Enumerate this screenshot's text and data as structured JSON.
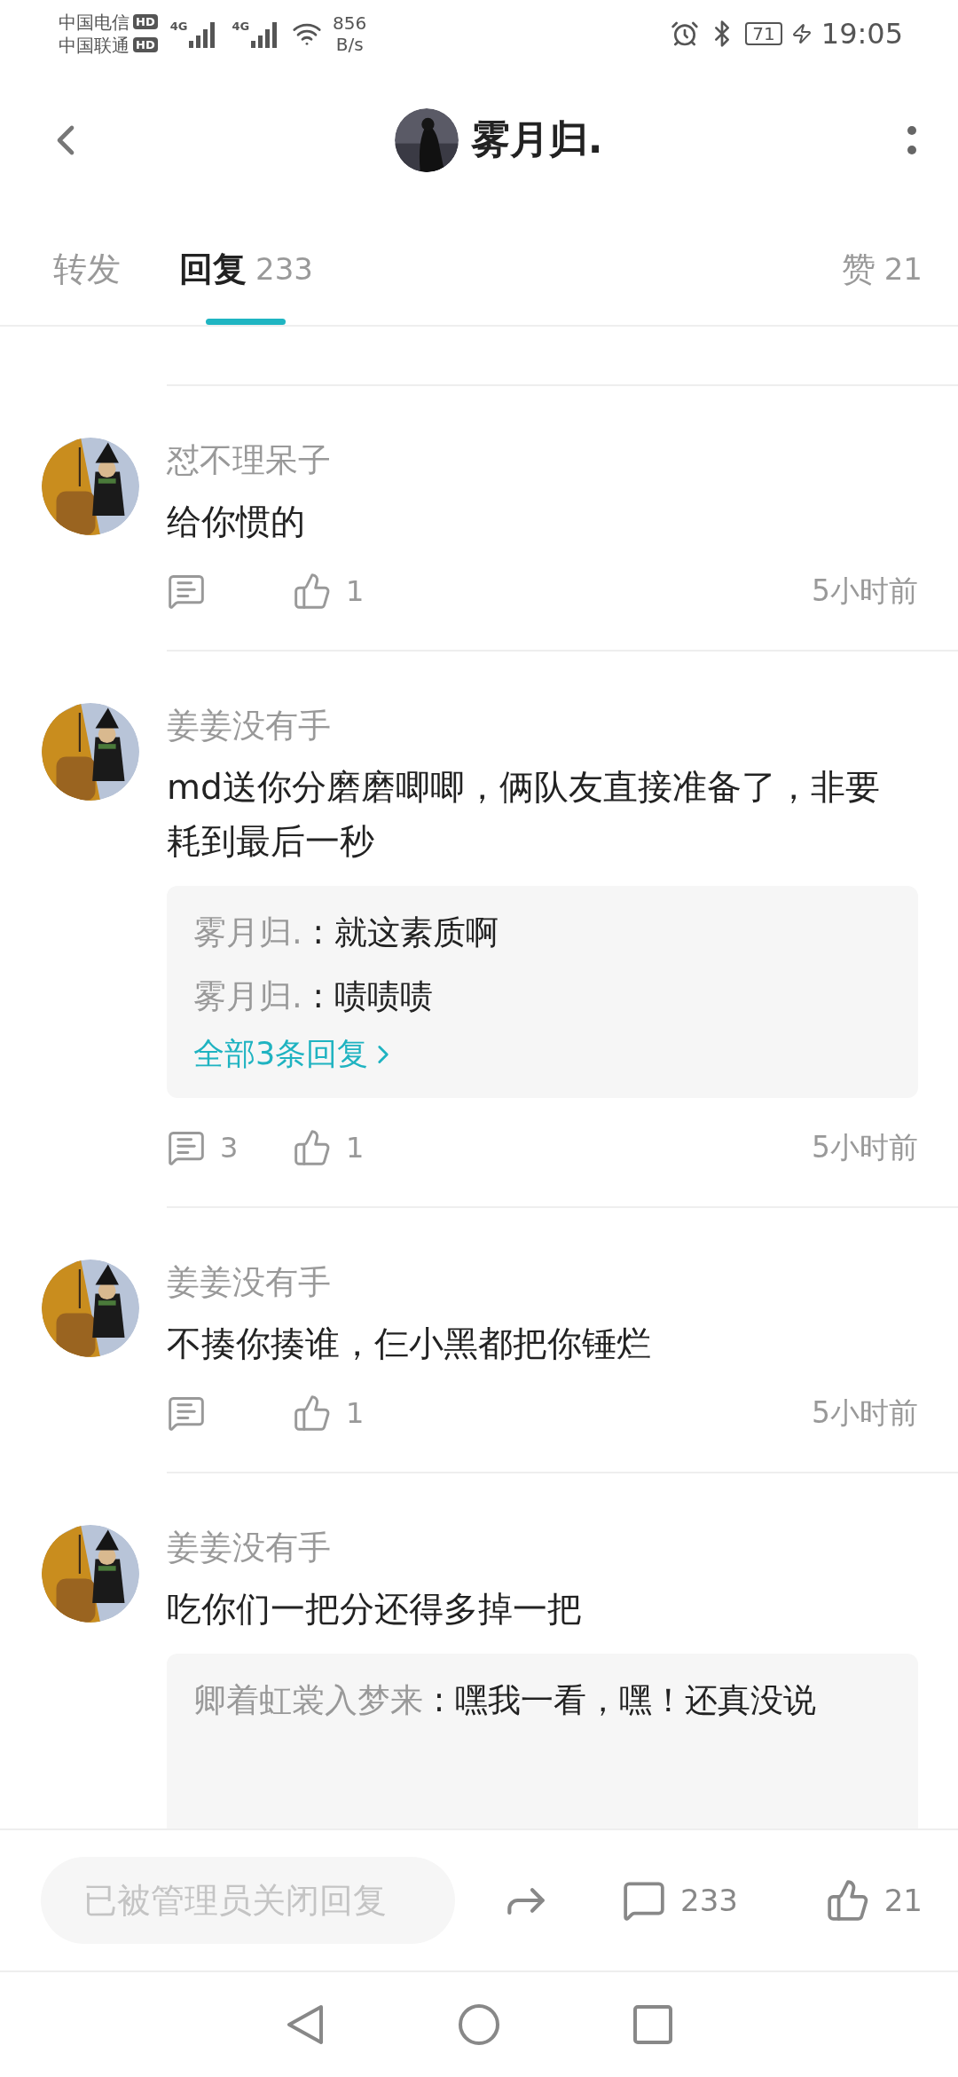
{
  "status_bar": {
    "carriers": [
      {
        "name": "中国电信",
        "badge": "HD"
      },
      {
        "name": "中国联通",
        "badge": "HD"
      }
    ],
    "network": [
      "4G",
      "4G"
    ],
    "speed": "856",
    "speed_unit": "B/s",
    "battery": "71",
    "time": "19:05"
  },
  "header": {
    "title": "雾月归."
  },
  "tabs": [
    {
      "label": "转发",
      "selected": false
    },
    {
      "label": "回复",
      "count": "233",
      "selected": true
    },
    {
      "label": "赞",
      "count": "21",
      "selected": false
    }
  ],
  "comments": [
    {
      "author": "怼不理呆子",
      "text": "给你惯的",
      "likes": "1",
      "time": "5小时前"
    },
    {
      "author": "姜姜没有手",
      "text": "md送你分磨磨唧唧，俩队友直接准备了，非要耗到最后一秒",
      "replies": [
        {
          "author": "雾月归.",
          "separator": ":",
          "text": "就这素质啊"
        },
        {
          "author": "雾月归.",
          "separator": ":",
          "text": "啧啧啧"
        }
      ],
      "more": "全部3条回复",
      "reply_count": "3",
      "likes": "1",
      "time": "5小时前"
    },
    {
      "author": "姜姜没有手",
      "text": "不揍你揍谁，仨小黑都把你锤烂",
      "likes": "1",
      "time": "5小时前"
    },
    {
      "author": "姜姜没有手",
      "text": "吃你们一把分还得多掉一把",
      "replies": [
        {
          "author": "卿着虹裳入梦来",
          "separator": ":",
          "text": "嘿我一看，嘿！还真没说"
        }
      ]
    }
  ],
  "bottom_bar": {
    "placeholder": "已被管理员关闭回复",
    "comment_count": "233",
    "like_count": "21"
  }
}
